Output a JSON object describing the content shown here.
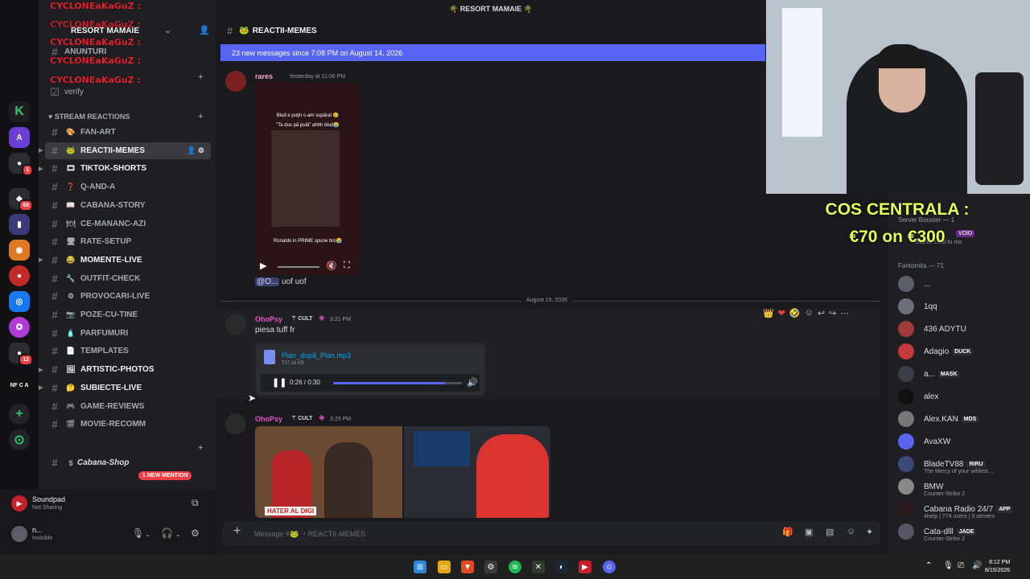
{
  "window": {
    "title": "🌴 RESORT MAMAIE 🌴"
  },
  "server": {
    "name": "RESORT MAMAIE",
    "overlay_name": "CYCLONEaKaGuZ :"
  },
  "sidebar": {
    "top_channels": [
      {
        "label": "ANUNTURI"
      },
      {
        "label": "verify"
      }
    ],
    "category": "STREAM REACTIONS",
    "channels": [
      {
        "label": "FAN-ART",
        "emoji": "🎨",
        "unread": false,
        "active": false
      },
      {
        "label": "REACTII-MEMES",
        "emoji": "🐸",
        "unread": true,
        "active": true
      },
      {
        "label": "TIKTOK-SHORTS",
        "emoji": "🎞",
        "unread": true,
        "active": false
      },
      {
        "label": "Q-AND-A",
        "emoji": "❓",
        "unread": false,
        "active": false
      },
      {
        "label": "CABANA-STORY",
        "emoji": "📖",
        "unread": false,
        "active": false
      },
      {
        "label": "CE-MANANC-AZI",
        "emoji": "🍽",
        "unread": false,
        "active": false
      },
      {
        "label": "RATE-SETUP",
        "emoji": "🖥",
        "unread": false,
        "active": false
      },
      {
        "label": "MOMENTE-LIVE",
        "emoji": "😂",
        "unread": true,
        "active": false
      },
      {
        "label": "OUTFIT-CHECK",
        "emoji": "🔧",
        "unread": false,
        "active": false
      },
      {
        "label": "PROVOCARI-LIVE",
        "emoji": "⚙",
        "unread": false,
        "active": false
      },
      {
        "label": "POZE-CU-TINE",
        "emoji": "📷",
        "unread": false,
        "active": false
      },
      {
        "label": "PARFUMURI",
        "emoji": "🧴",
        "unread": false,
        "active": false
      },
      {
        "label": "TEMPLATES",
        "emoji": "📄",
        "unread": false,
        "active": false
      },
      {
        "label": "ARTISTIC-PHOTOS",
        "emoji": "🖼",
        "unread": true,
        "active": false
      },
      {
        "label": "SUBIECTE-LIVE",
        "emoji": "🤔",
        "unread": true,
        "active": false
      },
      {
        "label": "GAME-REVIEWS",
        "emoji": "🎮",
        "unread": false,
        "active": false
      },
      {
        "label": "MOVIE-RECOMM",
        "emoji": "🎬",
        "unread": false,
        "active": false
      }
    ],
    "shop_channel": "Cabana-Shop",
    "new_mention": "1 NEW MENTION"
  },
  "user_panel": {
    "app_name": "Soundpad",
    "app_status": "Not Sharing",
    "user_name": "n...",
    "user_status": "Invisible"
  },
  "chat": {
    "channel_name": "REACTII-MEMES",
    "new_messages_bar": "23 new messages since 7:08 PM on August 14, 2026",
    "messages": [
      {
        "author": "rares",
        "timestamp": "Yesterday at 11:06 PM",
        "video_caption_top": "Blud e puțin c-am supărat 😢",
        "video_caption_sub": "\"Ta dus pă pulă\" ahhh blud😭",
        "video_caption_bottom": "Ronaldo in PRIME spune bro😭",
        "reply_mention": "@O...",
        "text": "uof uof"
      },
      {
        "author": "OhoPsy",
        "badge": "CULT",
        "timestamp": "3:21 PM",
        "text": "piesa tuff fr",
        "file_name": "Plan_după_Plan.mp3",
        "file_size": "727.16 KB",
        "audio_time": "0:26 / 0:30",
        "audio_progress": 0.87
      },
      {
        "author": "OhoPsy",
        "badge": "CULT",
        "timestamp": "3:29 PM",
        "image_caption": "HATER AL DIGI"
      }
    ],
    "date_divider": "August 15, 2026",
    "message_placeholder": "Message #🐸 ・REACTII-MEMES"
  },
  "promo": {
    "line1": "COS CENTRALA :",
    "line2": "€70 on €300"
  },
  "members": {
    "role_header": "Server Booster — 1",
    "booster_sub": "Înainte crezi tu ma",
    "booster_tag": "VOID",
    "group_header": "Fantomita — 71",
    "list": [
      {
        "name": "...",
        "tag": "",
        "sub": "",
        "color": "#5b5f6b"
      },
      {
        "name": "1qq",
        "tag": "",
        "sub": "",
        "color": "#6b6f7a"
      },
      {
        "name": "436 ADYTU",
        "tag": "",
        "sub": "",
        "color": "#a03a3a"
      },
      {
        "name": "Adagio",
        "tag": "DUCK",
        "sub": "",
        "color": "#c23a3a"
      },
      {
        "name": "a...",
        "tag": "MASK",
        "sub": "",
        "color": "#3a3e48"
      },
      {
        "name": "alex",
        "tag": "",
        "sub": "",
        "color": "#111"
      },
      {
        "name": "Alex.KAN",
        "tag": "MDS",
        "sub": "",
        "color": "#777"
      },
      {
        "name": "AvaXW",
        "tag": "",
        "sub": "",
        "color": "#5865f2"
      },
      {
        "name": "BladeTV88",
        "tag": "RIRU",
        "sub": "The Mercy of your wildest ...",
        "color": "#3a4a7a"
      },
      {
        "name": "BMW",
        "tag": "",
        "sub": "Counter-Strike 2",
        "color": "#888"
      },
      {
        "name": "Cabana Radio 24/7",
        "tag": "APP",
        "sub": "4help | 774 users | 3 servers",
        "color": "#2a1a1a"
      },
      {
        "name": "Cata-dlll",
        "tag": "JADE",
        "sub": "Counter-Strike 2",
        "color": "#556"
      }
    ]
  },
  "taskbar": {
    "time": "8:12 PM",
    "date": "8/15/2026"
  },
  "servers": {
    "badges": [
      "1",
      "68",
      "12"
    ],
    "labels": [
      "A",
      "NF C A"
    ]
  },
  "colors": {
    "accent": "#5865f2",
    "promo": "#e8ff5a",
    "overlay_text": "#e3212e",
    "mention": "#f23f43"
  }
}
